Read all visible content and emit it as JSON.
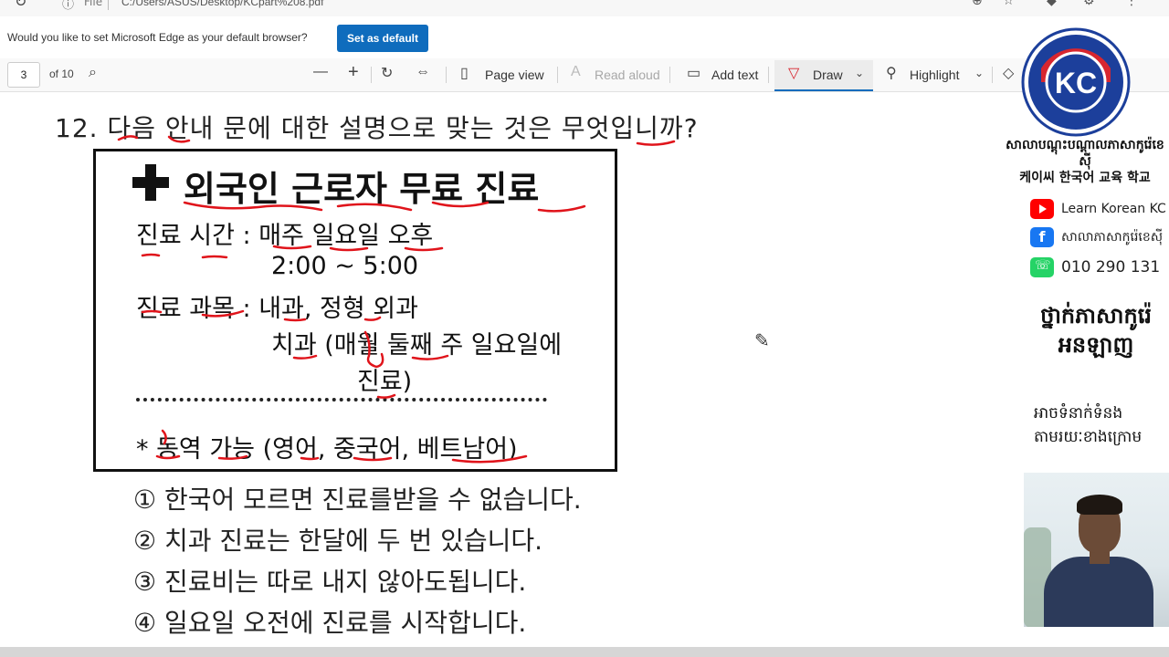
{
  "browser": {
    "file_label": "File",
    "url": "C:/Users/ASUS/Desktop/KCpart%208.pdf"
  },
  "banner": {
    "message": "Would you like to set Microsoft Edge as your default browser?",
    "button": "Set as default"
  },
  "toolbar": {
    "page_current": "3",
    "page_total": "of 10",
    "page_view": "Page view",
    "read_aloud": "Read aloud",
    "add_text": "Add text",
    "draw": "Draw",
    "highlight": "Highlight"
  },
  "document": {
    "question": "12. 다음 안내 문에 대한 설명으로 맞는 것은 무엇입니까?",
    "notice": {
      "title": "외국인 근로자 무료 진료",
      "line1": "진료 시간 : 매주 일요일 오후",
      "line2": "2:00 ~ 5:00",
      "line3": "진료 과목 : 내과, 정형 외과",
      "line4": "치과 (매월 둘째 주 일요일에",
      "line5": "진료)",
      "line6": "* 동역 가능 (영어, 중국어, 베트남어)"
    },
    "options": [
      "① 한국어 모르면 진료를받을 수 없습니다.",
      "② 치과 진료는 한달에 두 번 있습니다.",
      "③ 진료비는 따로 내지 않아도됩니다.",
      "④ 일요일 오전에 진료를 시작합니다."
    ]
  },
  "branding": {
    "logo_text": "KC",
    "school_khmer": "សាលាបណ្តុះបណ្តាលភាសាកូរ៉េខេស៊ី",
    "school_korean": "케이씨 한국어 교육 학교",
    "youtube": "Learn Korean KC",
    "facebook": "សាលាភាសាកូរ៉េខេស៊ី",
    "phone": "010 290 131",
    "class_khmer_1": "ថ្នាក់ភាសាកូរ៉េ",
    "class_khmer_2": "អនឡាញ",
    "contact_khmer_1": "អាចទំនាក់ទំនង",
    "contact_khmer_2": "តាមរយៈខាងក្រោម"
  },
  "colors": {
    "accent": "#0f6cbd",
    "ink": "#e0141b",
    "logo_red": "#d7262f",
    "logo_blue": "#1c3f9b"
  }
}
